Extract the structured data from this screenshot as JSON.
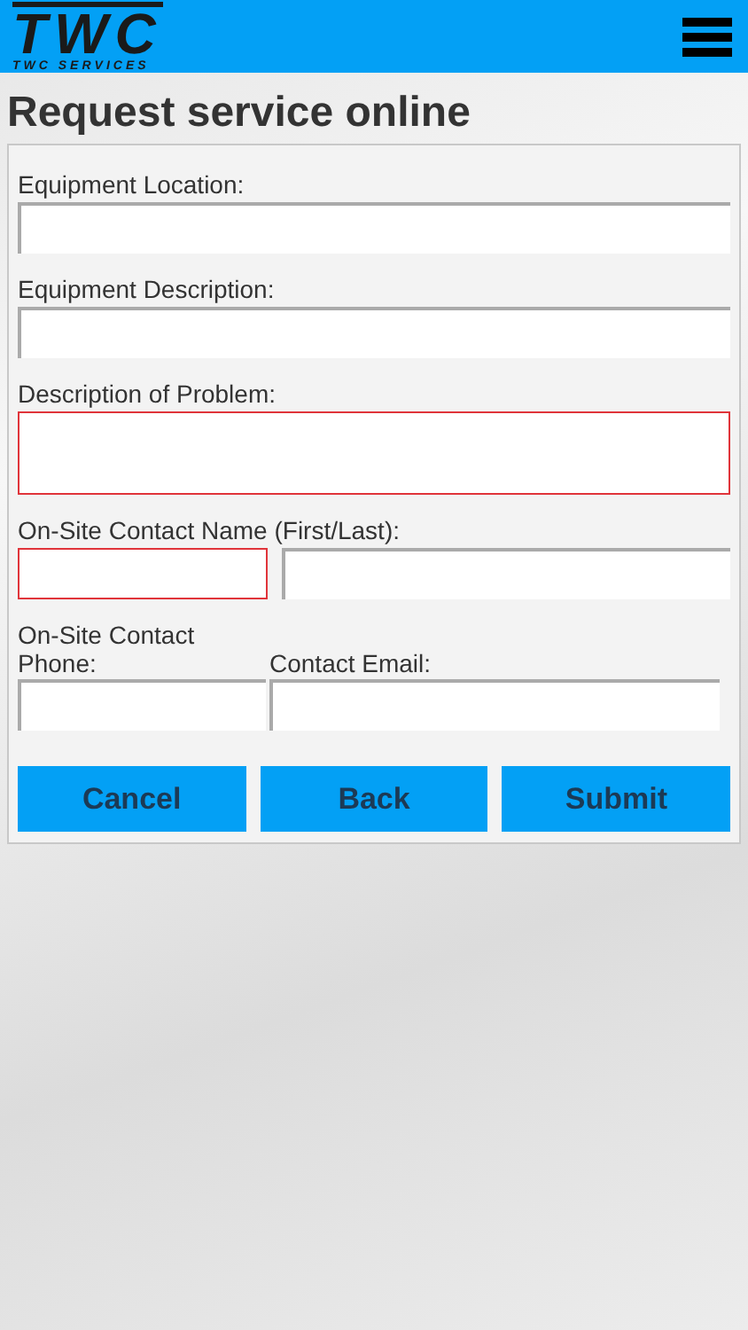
{
  "header": {
    "logo_text": "TWC",
    "logo_subtitle": "TWC SERVICES"
  },
  "title": "Request service online",
  "rows": [
    {
      "label": "Equipment Location:",
      "fields": [
        {
          "kind": "input",
          "invalid": false
        }
      ]
    },
    {
      "label": "Equipment Description:",
      "fields": [
        {
          "kind": "input",
          "invalid": false
        }
      ]
    },
    {
      "label": "Description of Problem:",
      "fields": [
        {
          "kind": "textarea",
          "invalid": true
        }
      ]
    },
    {
      "label": "On-Site Contact Name (First/Last):",
      "fields": [
        {
          "kind": "input",
          "invalid": true
        },
        {
          "kind": "input",
          "invalid": false
        }
      ]
    },
    {
      "fields": [
        {
          "kind": "input",
          "label": "On-Site Contact Phone:",
          "invalid": false
        },
        {
          "kind": "input",
          "label": "Contact Email:",
          "invalid": false
        }
      ]
    }
  ],
  "buttons": [
    "Cancel",
    "Back",
    "Submit"
  ]
}
